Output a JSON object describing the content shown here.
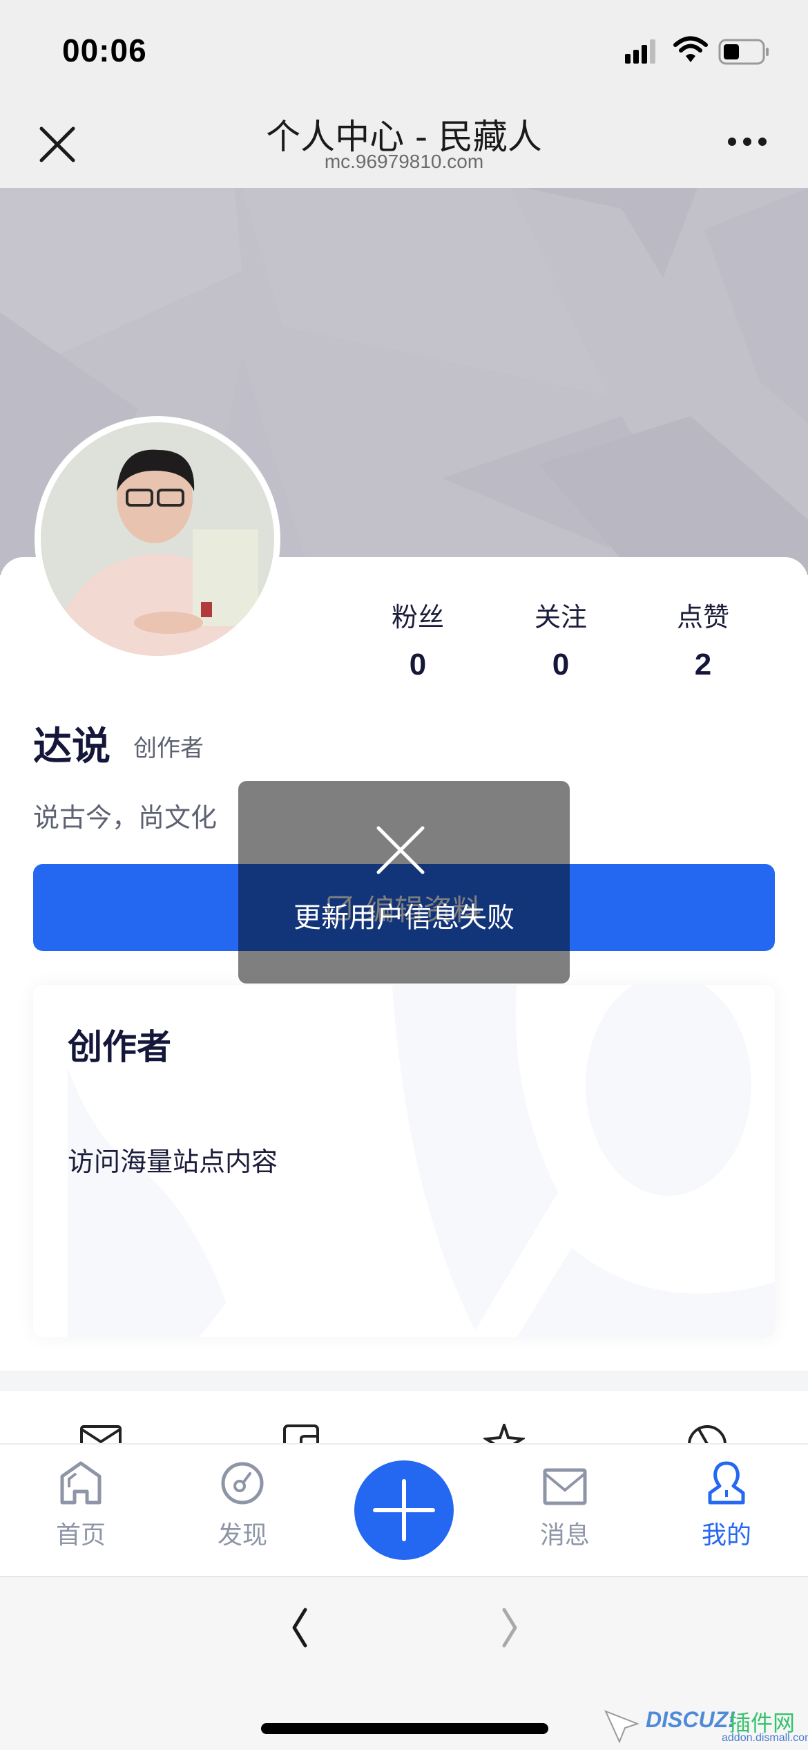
{
  "status_bar": {
    "time": "00:06"
  },
  "nav": {
    "title": "个人中心 - 民藏人",
    "url": "mc.96979810.com"
  },
  "profile": {
    "name": "达说",
    "tag": "创作者",
    "bio": "说古今，尚文化",
    "stats": [
      {
        "label": "粉丝",
        "value": "0"
      },
      {
        "label": "关注",
        "value": "0"
      },
      {
        "label": "点赞",
        "value": "2"
      }
    ],
    "edit_button_label": "编辑资料"
  },
  "creator_card": {
    "title": "创作者",
    "description": "访问海量站点内容"
  },
  "toast": {
    "icon": "close-x-icon",
    "message": "更新用户信息失败"
  },
  "tab_bar": {
    "items": [
      {
        "label": "首页",
        "icon": "home-icon",
        "active": false
      },
      {
        "label": "发现",
        "icon": "compass-icon",
        "active": false
      },
      {
        "label": "",
        "icon": "plus-icon",
        "active": false
      },
      {
        "label": "消息",
        "icon": "mail-icon",
        "active": false
      },
      {
        "label": "我的",
        "icon": "user-icon",
        "active": true
      }
    ],
    "accent_color": "#2468f2",
    "inactive_color": "#8d95a6"
  },
  "watermark": {
    "brand": "DISCUZ!",
    "cn": "插件网",
    "url": "addon.dismall.com"
  }
}
